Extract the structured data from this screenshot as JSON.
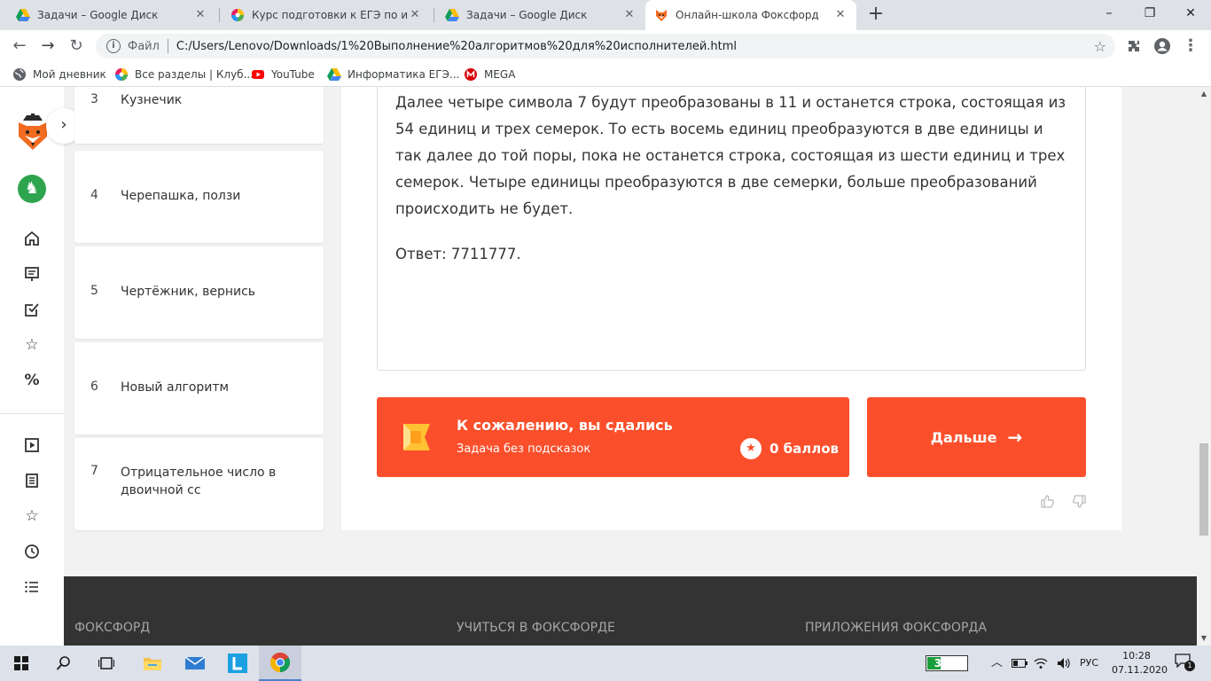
{
  "browser": {
    "tabs": [
      {
        "title": "Задачи – Google Диск",
        "icon": "google-drive-icon"
      },
      {
        "title": "Курс подготовки к ЕГЭ по инфо",
        "icon": "chrome-colorwheel-icon"
      },
      {
        "title": "Задачи – Google Диск",
        "icon": "google-drive-icon"
      },
      {
        "title": "Онлайн-школа Фоксфорд",
        "icon": "foxford-fox-icon"
      }
    ],
    "new_tab": "+",
    "window_controls": {
      "minimize": "–",
      "maximize": "❐",
      "close": "✕"
    },
    "address": {
      "scheme_label": "Файл",
      "url": "C:/Users/Lenovo/Downloads/1%20Выполнение%20алгоритмов%20для%20исполнителей.html"
    },
    "bookmarks": [
      {
        "label": "Мой дневник",
        "icon": "globe-icon"
      },
      {
        "label": "Все разделы | Клуб...",
        "icon": "colorwheel-icon"
      },
      {
        "label": "YouTube",
        "icon": "youtube-icon"
      },
      {
        "label": "Информатика ЕГЭ...",
        "icon": "google-drive-icon"
      },
      {
        "label": "MEGA",
        "icon": "mega-icon"
      }
    ]
  },
  "tasks": [
    {
      "num": "3",
      "title": "Кузнечик"
    },
    {
      "num": "4",
      "title": "Черепашка, ползи"
    },
    {
      "num": "5",
      "title": "Чертёжник, вернись"
    },
    {
      "num": "6",
      "title": "Новый алгоритм"
    },
    {
      "num": "7",
      "title": "Отрицательное число в двоичной сс"
    }
  ],
  "solution": {
    "text": "Далее четыре символа 7 будут преобразованы в 11 и  останется строка, состоящая из 54 единиц и трех семерок. То есть восемь единиц преобразуются в две единицы и так далее до той поры, пока не останется строка, состоящая из шести единиц и трех семерок. Четыре единицы преобразуются в две семерки, больше преобразований происходить не будет.",
    "answer": "Ответ: 7711777."
  },
  "result": {
    "title": "К сожалению, вы сдались",
    "subtitle": "Задача без подсказок",
    "score": "0 баллов",
    "next_label": "Дальше",
    "next_arrow": "→"
  },
  "footer": {
    "col1": "ФОКСФОРД",
    "col2": "УЧИТЬСЯ В ФОКСФОРДЕ",
    "col3": "ПРИЛОЖЕНИЯ ФОКСФОРДА"
  },
  "taskbar": {
    "battery_label": "35%",
    "battery_level": 0.35,
    "language": "РУС",
    "time": "10:28",
    "date": "07.11.2020",
    "notification_count": "1"
  },
  "colors": {
    "accent": "#fb4f2b",
    "footer_bg": "#333333",
    "badge_green": "#2ea44f"
  }
}
